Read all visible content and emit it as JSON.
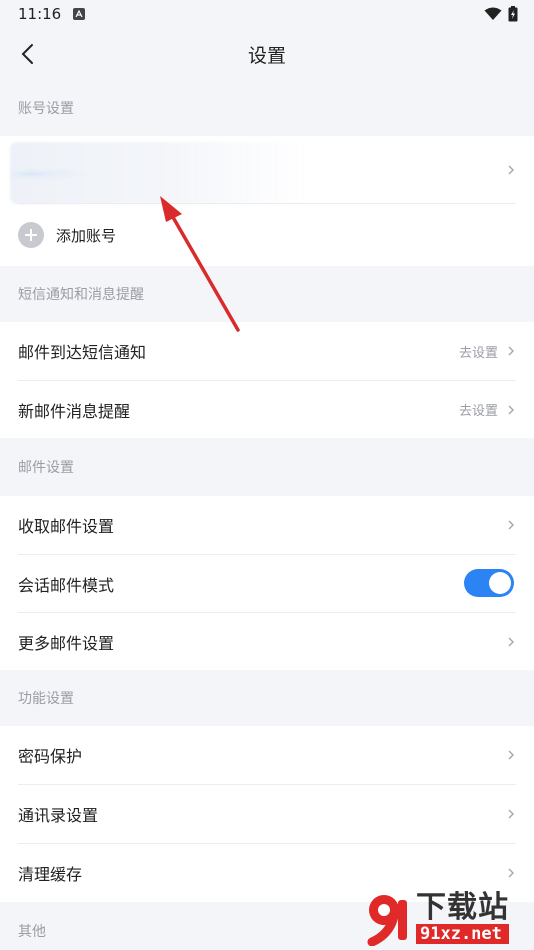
{
  "status_bar": {
    "time": "11:16"
  },
  "header": {
    "title": "设置"
  },
  "sections": {
    "account": {
      "title": "账号设置",
      "add_account_label": "添加账号"
    },
    "sms": {
      "title": "短信通知和消息提醒",
      "items": [
        {
          "label": "邮件到达短信通知",
          "hint": "去设置"
        },
        {
          "label": "新邮件消息提醒",
          "hint": "去设置"
        }
      ]
    },
    "mail": {
      "title": "邮件设置",
      "items": [
        {
          "label": "收取邮件设置"
        },
        {
          "label": "会话邮件模式",
          "toggle_on": true
        },
        {
          "label": "更多邮件设置"
        }
      ]
    },
    "features": {
      "title": "功能设置",
      "items": [
        {
          "label": "密码保护"
        },
        {
          "label": "通讯录设置"
        },
        {
          "label": "清理缓存"
        }
      ]
    },
    "other": {
      "title": "其他"
    }
  },
  "watermark": {
    "title": "下载站",
    "site": "91xz.net"
  },
  "colors": {
    "accent": "#2c83f3",
    "annotation": "#d92b2b",
    "page_bg": "#f4f5f9",
    "watermark_red": "#e02a2a"
  },
  "icons": {
    "back": "chevron-left-icon",
    "chevron": "chevron-right-icon",
    "add": "plus-circle-icon",
    "wifi": "wifi-icon",
    "battery": "battery-charging-icon"
  }
}
